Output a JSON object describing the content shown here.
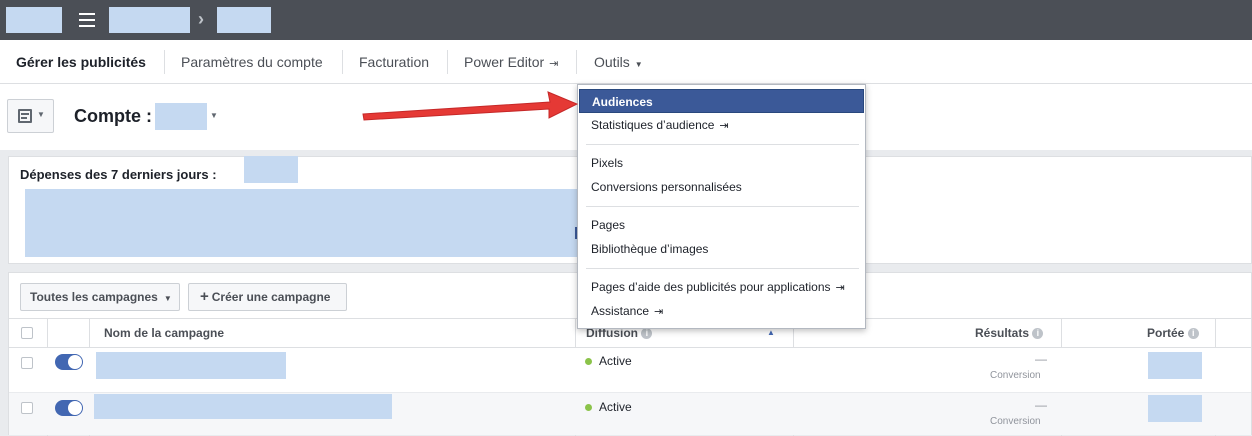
{
  "topbar": {
    "breadcrumb_separator": "›",
    "menu_icon": "hamburger-icon"
  },
  "nav": {
    "tabs": [
      {
        "label": "Gérer les publicités",
        "active": true
      },
      {
        "label": "Paramètres du compte"
      },
      {
        "label": "Facturation"
      },
      {
        "label": "Power Editor",
        "icon": "external-link-icon"
      },
      {
        "label": "Outils",
        "icon": "caret-down-icon"
      }
    ]
  },
  "account": {
    "label": "Compte :"
  },
  "spend": {
    "label": "Dépenses des 7 derniers jours : "
  },
  "campaigns": {
    "filter_label": "Toutes les campagnes",
    "create_label": "Créer une campagne",
    "columns": {
      "name": "Nom de la campagne",
      "delivery": "Diffusion",
      "results": "Résultats",
      "reach": "Portée"
    },
    "rows": [
      {
        "status": "Active",
        "result": "—",
        "result_type": "Conversion"
      },
      {
        "status": "Active",
        "result": "—",
        "result_type": "Conversion"
      }
    ]
  },
  "tools_menu": {
    "items": [
      {
        "label": "Audiences",
        "selected": true
      },
      {
        "label": "Statistiques d’audience",
        "external": true
      },
      {
        "label": "Pixels"
      },
      {
        "label": "Conversions personnalisées"
      },
      {
        "label": "Pages"
      },
      {
        "label": "Bibliothèque d’images"
      },
      {
        "label": "Pages d’aide des publicités pour applications",
        "external": true
      },
      {
        "label": "Assistance",
        "external": true
      }
    ]
  },
  "colors": {
    "selected": "#3b5998",
    "status_active": "#8bc34a",
    "toggle": "#4267b2",
    "arrow": "#e53935"
  }
}
